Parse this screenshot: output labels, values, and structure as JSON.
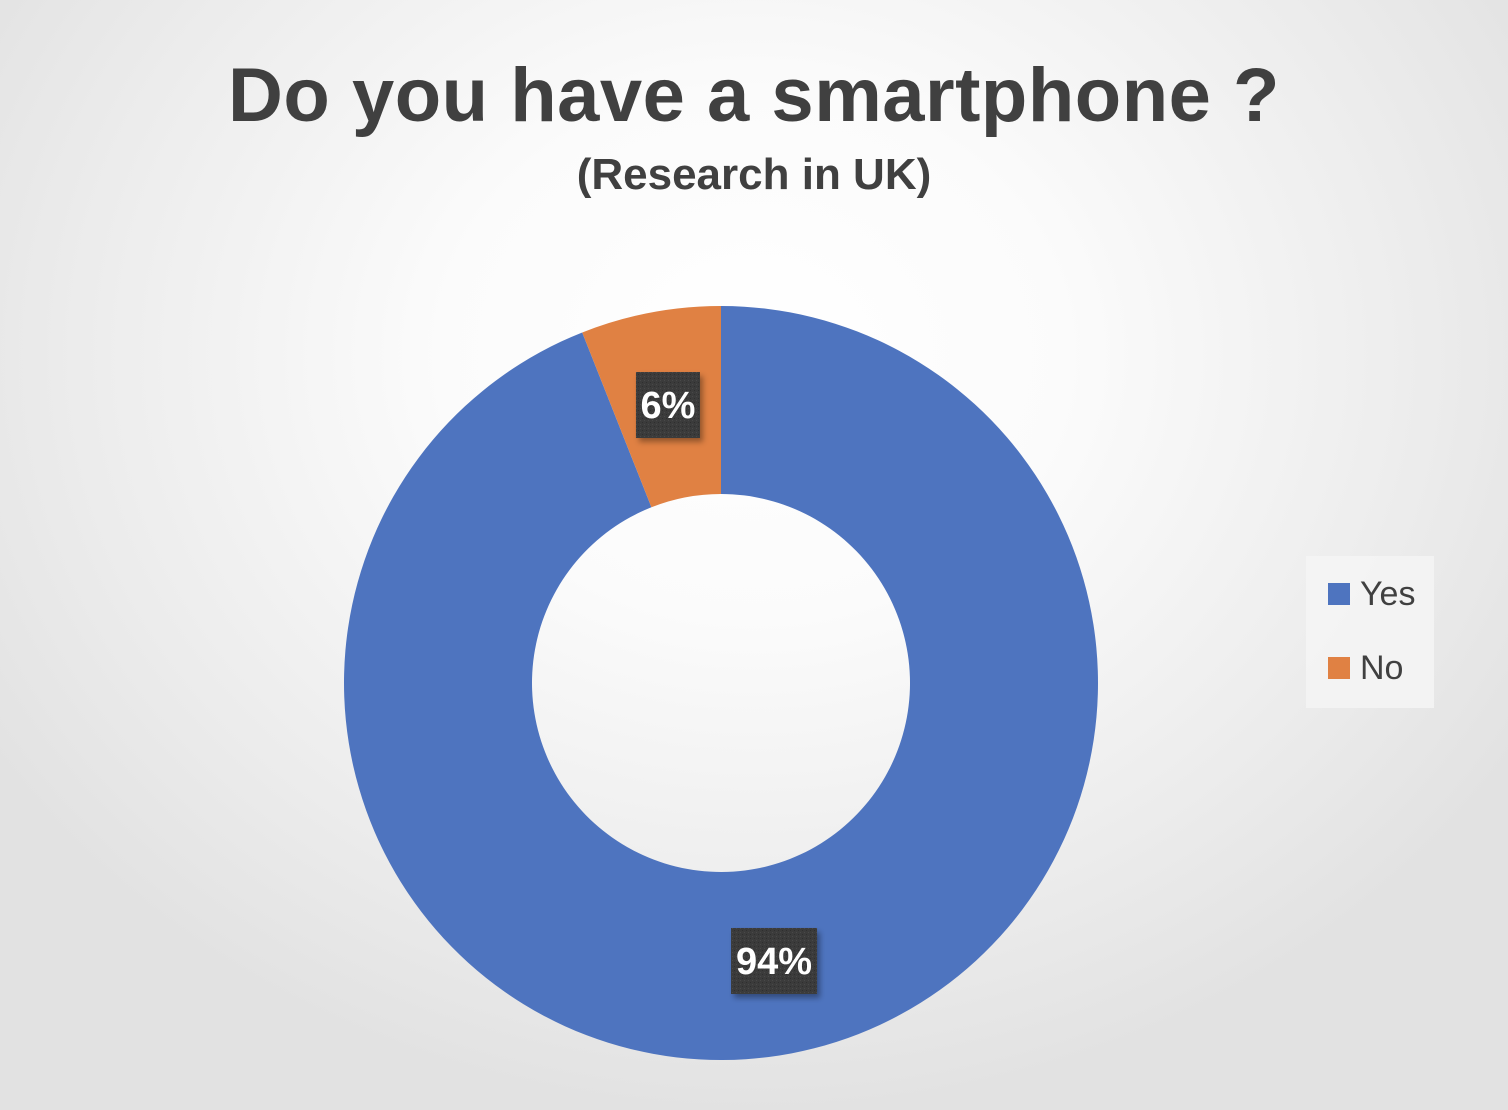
{
  "chart_data": {
    "type": "donut",
    "title": "Do you have a smartphone ?",
    "subtitle": "(Research in UK)",
    "categories": [
      "Yes",
      "No"
    ],
    "values": [
      94,
      6
    ],
    "data_labels": [
      "94%",
      "6%"
    ],
    "colors": [
      "#4E74BF",
      "#E08143"
    ],
    "legend": {
      "position": "right",
      "entries": [
        "Yes",
        "No"
      ]
    }
  }
}
